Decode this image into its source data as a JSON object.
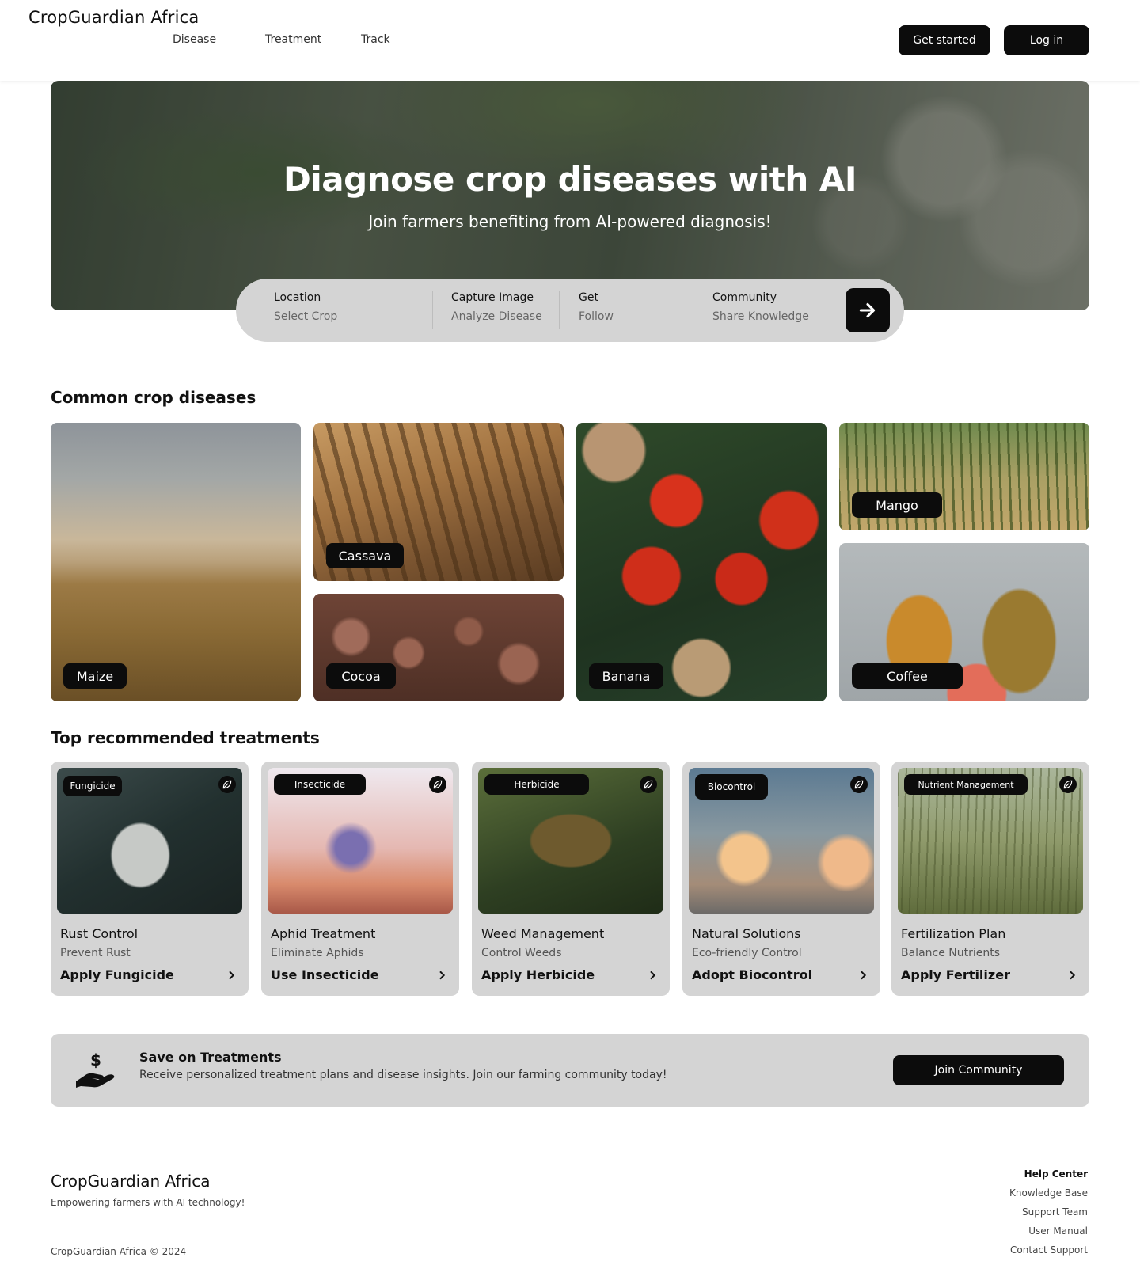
{
  "brand": "CropGuardian Africa",
  "nav": {
    "links": [
      "Disease",
      "Treatment",
      "Track"
    ],
    "get_started": "Get started",
    "log_in": "Log in"
  },
  "hero": {
    "title": "Diagnose crop diseases with AI",
    "subtitle": "Join farmers benefiting from AI-powered diagnosis!"
  },
  "search": {
    "segments": [
      {
        "title": "Location",
        "sub": "Select Crop"
      },
      {
        "title": "Capture Image",
        "sub": "Analyze Disease"
      },
      {
        "title": "Get",
        "sub": "Follow"
      },
      {
        "title": "Community",
        "sub": "Share Knowledge"
      }
    ],
    "go_icon": "arrow-right-icon"
  },
  "diseases": {
    "title": "Common crop diseases",
    "tiles": [
      "Maize",
      "Cassava",
      "Cocoa",
      "Banana",
      "Mango",
      "Coffee"
    ]
  },
  "treatments": {
    "title": "Top recommended treatments",
    "cards": [
      {
        "tag": "Fungicide",
        "title": "Rust Control",
        "sub": "Prevent Rust",
        "action": "Apply Fungicide"
      },
      {
        "tag": "Insecticide",
        "title": "Aphid Treatment",
        "sub": "Eliminate Aphids",
        "action": "Use Insecticide"
      },
      {
        "tag": "Herbicide",
        "title": "Weed Management",
        "sub": "Control Weeds",
        "action": "Apply Herbicide"
      },
      {
        "tag": "Biocontrol",
        "title": "Natural Solutions",
        "sub": "Eco-friendly Control",
        "action": "Adopt Biocontrol"
      },
      {
        "tag": "Nutrient Management",
        "title": "Fertilization Plan",
        "sub": "Balance Nutrients",
        "action": "Apply Fertilizer"
      }
    ]
  },
  "banner": {
    "title": "Save on Treatments",
    "text": "Receive personalized treatment plans and disease insights. Join our farming community today!",
    "button": "Join Community",
    "icon": "hand-dollar-icon"
  },
  "footer": {
    "brand": "CropGuardian Africa",
    "tagline": "Empowering farmers with AI technology!",
    "copyright": "CropGuardian Africa © 2024",
    "links_heading": "Help Center",
    "links": [
      "Knowledge Base",
      "Support Team",
      "User Manual",
      "Contact Support"
    ]
  },
  "colors": {
    "dark": "#0c0c0c",
    "panel": "#d4d4d4"
  }
}
